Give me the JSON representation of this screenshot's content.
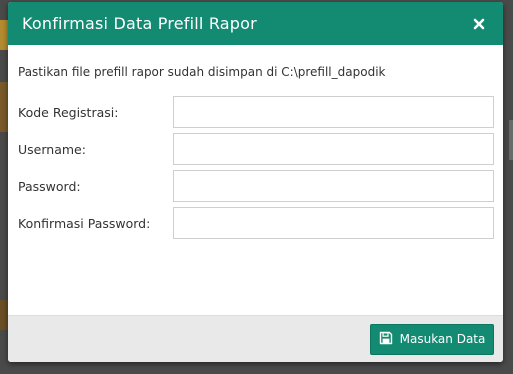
{
  "dialog": {
    "title": "Konfirmasi Data Prefill Rapor",
    "close_icon": "close-icon",
    "notice": "Pastikan file prefill rapor sudah disimpan di C:\\prefill_dapodik",
    "fields": [
      {
        "label": "Kode Registrasi:",
        "value": "",
        "placeholder": ""
      },
      {
        "label": "Username:",
        "value": "",
        "placeholder": ""
      },
      {
        "label": "Password:",
        "value": "",
        "placeholder": ""
      },
      {
        "label": "Konfirmasi Password:",
        "value": "",
        "placeholder": ""
      }
    ],
    "submit_label": "Masukan Data",
    "submit_icon": "save-icon"
  },
  "colors": {
    "header_bg": "#138a72",
    "button_bg": "#138a72",
    "footer_bg": "#e9e9e9",
    "backdrop": "#4a4a4a"
  }
}
